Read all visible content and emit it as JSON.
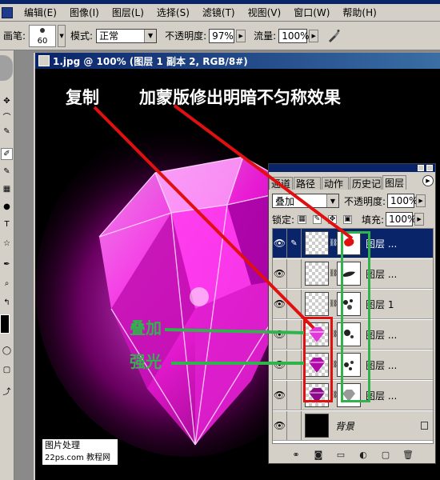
{
  "menubar": {
    "items": [
      "编辑(E)",
      "图像(I)",
      "图层(L)",
      "选择(S)",
      "滤镜(T)",
      "视图(V)",
      "窗口(W)",
      "帮助(H)"
    ]
  },
  "options": {
    "brush_label": "画笔:",
    "brush_size": "60",
    "mode_label": "模式:",
    "mode_value": "正常",
    "opacity_label": "不透明度:",
    "opacity_value": "97%",
    "flow_label": "流量:",
    "flow_value": "100%"
  },
  "document": {
    "title": "1.jpg @ 100% (图层 1 副本 2, RGB/8#)"
  },
  "annotations": {
    "copy": "复制",
    "mask": "加蒙版修出明暗不匀称效果",
    "overlay": "叠加",
    "hardlight": "强光"
  },
  "palette": {
    "tabs": [
      "通道",
      "路径",
      "动作",
      "历史记",
      "图层"
    ],
    "blend_mode": "叠加",
    "opacity_label": "不透明度:",
    "opacity_value": "100%",
    "lock_label": "锁定:",
    "fill_label": "填充:",
    "fill_value": "100%",
    "layers": [
      {
        "name": "图层 ..."
      },
      {
        "name": "图层 ..."
      },
      {
        "name": "图层 1"
      },
      {
        "name": "图层 ..."
      },
      {
        "name": "图层 ..."
      },
      {
        "name": "图层 ..."
      },
      {
        "name": "背景"
      }
    ]
  },
  "watermark": {
    "line1": "图片处理",
    "line2": "22ps.com 教程网"
  },
  "colors": {
    "annotation_red": "#e01010",
    "annotation_green": "#2fb34a",
    "gem_magenta": "#ff1ee8"
  }
}
